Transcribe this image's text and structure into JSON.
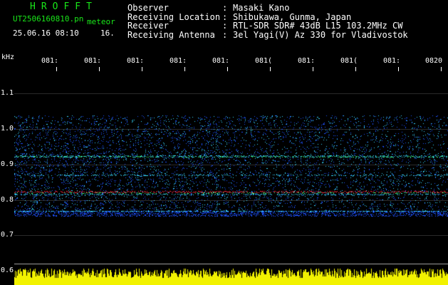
{
  "header": {
    "app_title": "HROFFT",
    "filename": "UT2506160810.pn",
    "meteor_label": "meteor",
    "datetime": "25.06.16 08:10",
    "count": "16.",
    "info": [
      {
        "label": "Observer",
        "value": "Masaki Kano"
      },
      {
        "label": "Receiving Location",
        "value": "Shibukawa, Gunma, Japan"
      },
      {
        "label": "Receiver",
        "value": "RTL-SDR SDR# 43dB L15 103.2MHz CW"
      },
      {
        "label": "Receiving Antenna",
        "value": "3el Yagi(V) Az 330 for Vladivostok"
      }
    ],
    "separator": ":"
  },
  "axes": {
    "y_unit": "kHz",
    "y_ticks": [
      "1.1",
      "1.0",
      "0.9",
      "0.8",
      "0.7",
      "0.6"
    ],
    "x_ticks": [
      "081:",
      "081:",
      "081:",
      "081:",
      "081:",
      "081(",
      "081:",
      "081(",
      "081:",
      "0820"
    ]
  },
  "colors": {
    "background": "#000000",
    "title_green": "#19e619",
    "text": "#ffffff",
    "signal_blue": "#1e50ff",
    "signal_cyan": "#38d8ff",
    "echo_red": "#ff2a3c",
    "echo_green": "#3cff7a",
    "bar_yellow": "#f2f200"
  }
}
